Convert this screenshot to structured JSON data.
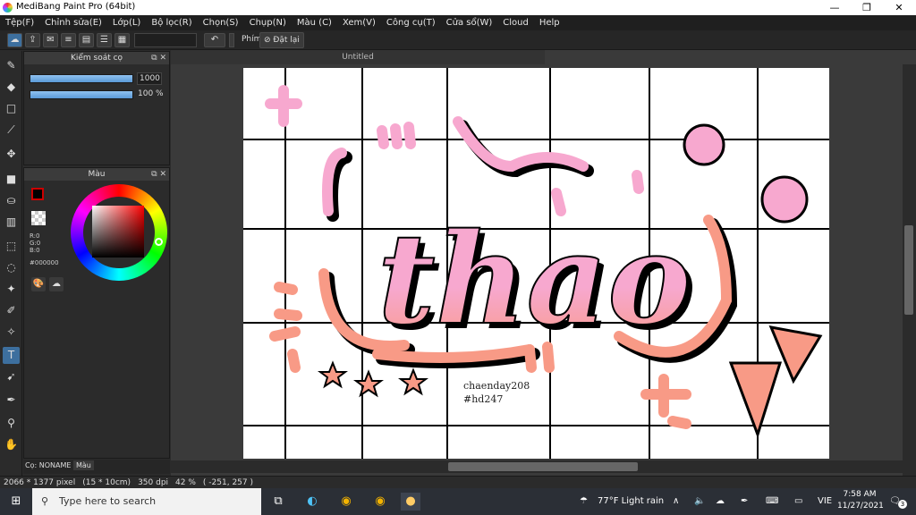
{
  "window": {
    "title": "MediBang Paint Pro (64bit)",
    "minimize": "—",
    "maximize": "❐",
    "close": "✕"
  },
  "menu": [
    "Tệp(F)",
    "Chỉnh sửa(E)",
    "Lớp(L)",
    "Bộ lọc(R)",
    "Chọn(S)",
    "Chụp(N)",
    "Màu (C)",
    "Xem(V)",
    "Công cụ(T)",
    "Cửa sổ(W)",
    "Cloud",
    "Help"
  ],
  "toolbar": {
    "phim_label": "Phím",
    "reset_label": "Đặt lại"
  },
  "brush_panel": {
    "title": "Kiểm soát cọ",
    "size_value": "1000",
    "opacity_value": "100 %"
  },
  "color_panel": {
    "title": "Màu",
    "r": "R:0",
    "g": "G:0",
    "b": "B:0",
    "hex": "#000000"
  },
  "bottom_tabs": {
    "tab1": "Cọ: NONAME",
    "tab2": "Màu"
  },
  "document": {
    "tab_title": "Untitled"
  },
  "artwork": {
    "word": "thao",
    "signature_line1": "chaenday208",
    "signature_line2": "#hd247"
  },
  "status": {
    "pixels": "2066 * 1377 pixel",
    "size": "(15 * 10cm)",
    "dpi": "350 dpi",
    "zoom": "42 %",
    "coords": "( -251, 257 )"
  },
  "taskbar": {
    "search_placeholder": "Type here to search",
    "weather": "77°F  Light rain",
    "lang": "VIE",
    "time": "7:58 AM",
    "date": "11/27/2021",
    "notif_count": "3"
  },
  "colors": {
    "pink": "#f7a8cf",
    "salmon": "#f89a86",
    "accent": "#3d6f9e"
  }
}
